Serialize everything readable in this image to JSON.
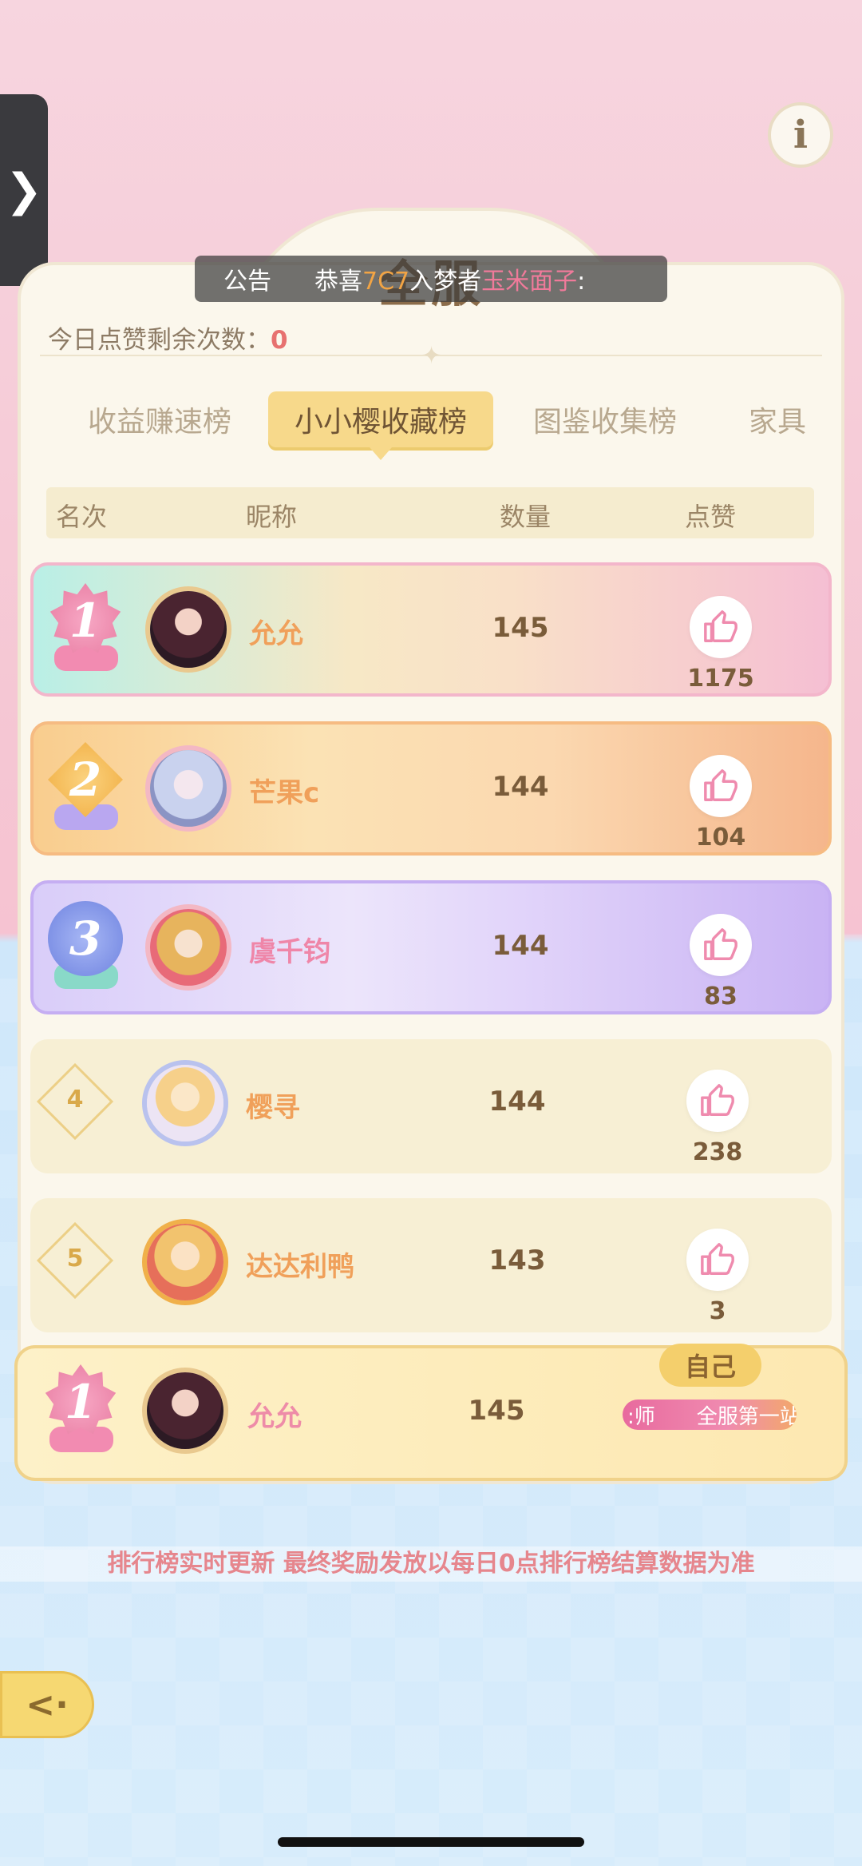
{
  "side_tab": {
    "icon": "chevron-right-icon",
    "glyph": "❯"
  },
  "info": {
    "icon": "info-icon",
    "glyph": "i"
  },
  "title": "全服",
  "notice": {
    "label": "公告",
    "text_prefix": "恭喜",
    "highlight_name": "7C7",
    "middle_text": "入梦者",
    "highlight_name2": "玉米面子",
    "suffix": ":"
  },
  "remaining": {
    "label": "今日点赞剩余次数：",
    "value": "0"
  },
  "tabs": [
    {
      "label": "收益赚速榜",
      "active": false
    },
    {
      "label": "小小樱收藏榜",
      "active": true
    },
    {
      "label": "图鉴收集榜",
      "active": false
    },
    {
      "label": "家具",
      "active": false
    }
  ],
  "headers": {
    "rank": "名次",
    "nickname": "昵称",
    "quantity": "数量",
    "likes": "点赞"
  },
  "rows": [
    {
      "rank": "1",
      "name": "允允",
      "quantity": "145",
      "likes": "1175"
    },
    {
      "rank": "2",
      "name": "芒果c",
      "quantity": "144",
      "likes": "104"
    },
    {
      "rank": "3",
      "name": "虞千钧",
      "quantity": "144",
      "likes": "83"
    },
    {
      "rank": "4",
      "name": "樱寻",
      "quantity": "144",
      "likes": "238"
    },
    {
      "rank": "5",
      "name": "达达利鸭",
      "quantity": "143",
      "likes": "3"
    }
  ],
  "self": {
    "tag": "自己",
    "rank": "1",
    "name": "允允",
    "quantity": "145",
    "title_badge": ":师　　全服第一站"
  },
  "bottom_note": "排行榜实时更新 最终奖励发放以每日0点排行榜结算数据为准",
  "colors": {
    "accent_gold": "#f7d98b",
    "name_orange": "#f0a05a",
    "count_brown": "#7a5c3a",
    "like_pink": "#f08bb0"
  }
}
